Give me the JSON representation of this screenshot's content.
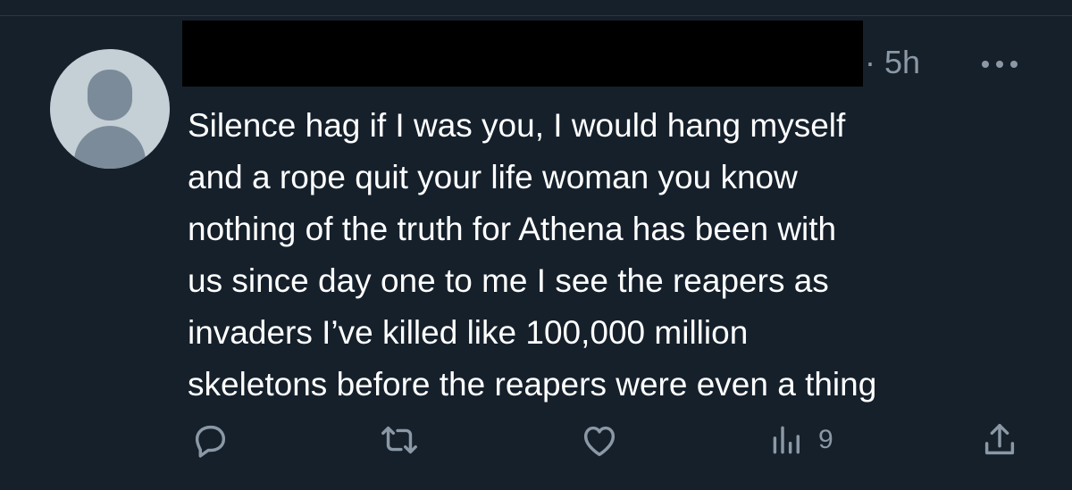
{
  "tweet": {
    "timestamp": "· 5h",
    "more_icon": "more-horizontal-icon",
    "lines": [
      "Silence hag if I was you, I would hang myself",
      "and a rope quit your life woman you know",
      "nothing of the truth for Athena has been with",
      "us since day one to me I see the reapers as",
      "invaders I’ve killed like 100,000 million",
      "skeletons before the reapers were even a thing"
    ]
  },
  "actions": {
    "reply_icon": "reply-icon",
    "retweet_icon": "retweet-icon",
    "like_icon": "heart-icon",
    "views_icon": "views-chart-icon",
    "views_count": "9",
    "share_icon": "share-icon"
  },
  "colors": {
    "background": "#15202b",
    "text_primary": "#ffffff",
    "text_secondary": "#8b98a5",
    "avatar_bg": "#c4cfd6",
    "avatar_fg": "#7b8b99"
  }
}
